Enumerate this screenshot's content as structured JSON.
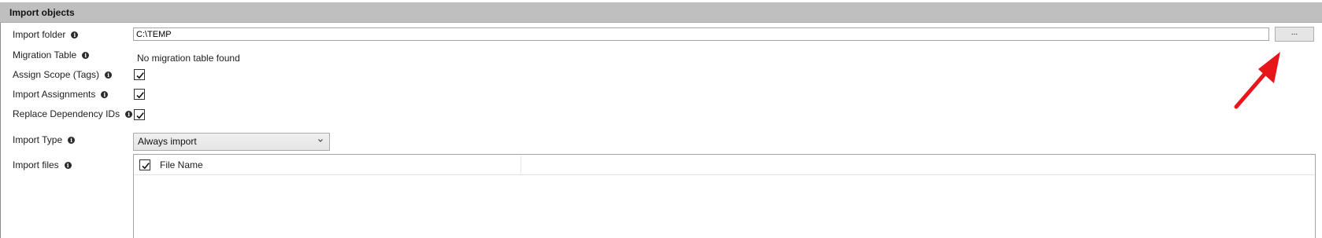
{
  "section": {
    "title": "Import objects"
  },
  "fields": {
    "import_folder": {
      "label": "Import folder",
      "value": "C:\\TEMP",
      "browse_label": "..."
    },
    "migration_table": {
      "label": "Migration Table",
      "value": "No migration table found"
    },
    "assign_scope": {
      "label": "Assign Scope (Tags)",
      "checked": true
    },
    "import_assignments": {
      "label": "Import Assignments",
      "checked": true
    },
    "replace_dependency_ids": {
      "label": "Replace Dependency IDs",
      "checked": true
    },
    "import_type": {
      "label": "Import Type",
      "selected": "Always import"
    },
    "import_files": {
      "label": "Import files",
      "columns": [
        "File Name"
      ],
      "select_all_checked": true,
      "rows": []
    }
  },
  "icons": {
    "info": "info-icon",
    "dropdown": "chevron-down-icon",
    "annotation": "red-arrow"
  },
  "colors": {
    "header_bg": "#bfbfbf",
    "arrow": "#e8161b"
  }
}
